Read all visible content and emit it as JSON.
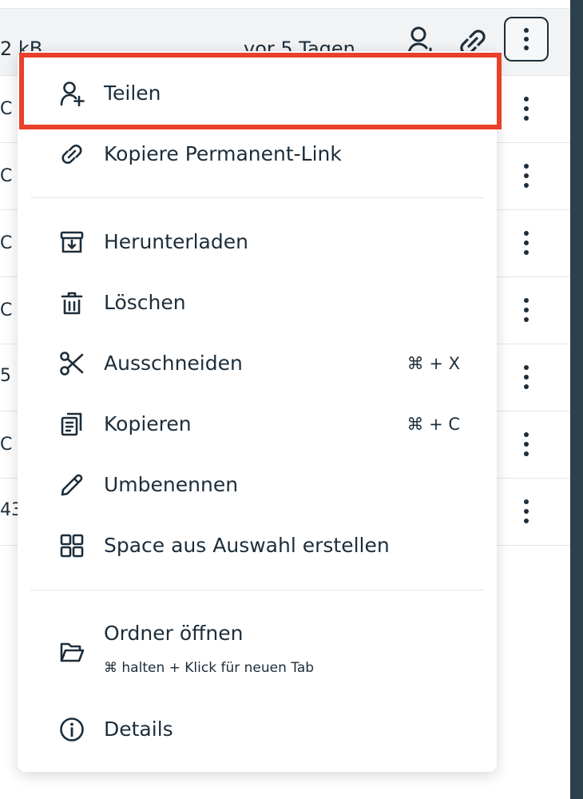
{
  "file_row": {
    "size": "2 kB",
    "modified": "vor 5 Tagen"
  },
  "background_rows": [
    {
      "fragment": "C"
    },
    {
      "fragment": "C"
    },
    {
      "fragment": "C"
    },
    {
      "fragment": "C"
    },
    {
      "fragment": "5"
    },
    {
      "fragment": "C"
    },
    {
      "fragment": "43"
    }
  ],
  "context_menu": {
    "items": [
      {
        "label": "Teilen",
        "icon": "share-user-icon"
      },
      {
        "label": "Kopiere Permanent-Link",
        "icon": "link-icon"
      },
      {
        "label": "Herunterladen",
        "icon": "download-icon"
      },
      {
        "label": "Löschen",
        "icon": "trash-icon"
      },
      {
        "label": "Ausschneiden",
        "icon": "scissors-icon",
        "shortcut": "⌘ + X"
      },
      {
        "label": "Kopieren",
        "icon": "copy-icon",
        "shortcut": "⌘ + C"
      },
      {
        "label": "Umbenennen",
        "icon": "pencil-icon"
      },
      {
        "label": "Space aus Auswahl erstellen",
        "icon": "grid-icon"
      },
      {
        "label": "Ordner öffnen",
        "icon": "folder-open-icon",
        "hint": "⌘ halten + Klick für neuen Tab"
      },
      {
        "label": "Details",
        "icon": "info-icon"
      }
    ]
  },
  "colors": {
    "highlight": "#e8402a",
    "text": "#1d2d3a",
    "sidebar_dark": "#2c404e"
  }
}
